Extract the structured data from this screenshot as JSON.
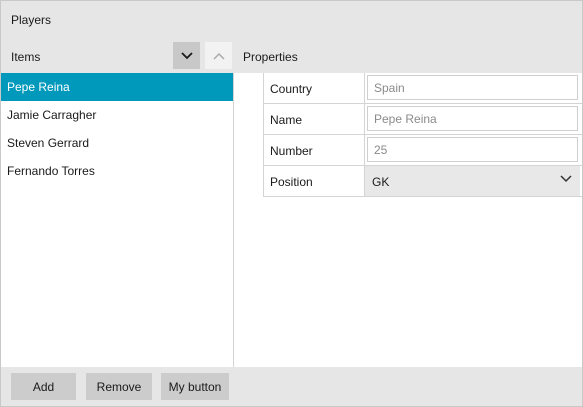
{
  "window": {
    "title": "Players"
  },
  "items_panel": {
    "header": "Items",
    "move_down_icon": "chevron-down-icon",
    "move_up_icon": "chevron-up-icon",
    "items": [
      {
        "label": "Pepe Reina",
        "selected": true
      },
      {
        "label": "Jamie Carragher",
        "selected": false
      },
      {
        "label": "Steven Gerrard",
        "selected": false
      },
      {
        "label": "Fernando Torres",
        "selected": false
      }
    ]
  },
  "properties_panel": {
    "header": "Properties",
    "rows": [
      {
        "label": "Country",
        "value": "Spain"
      },
      {
        "label": "Name",
        "value": "Pepe Reina"
      },
      {
        "label": "Number",
        "value": "25"
      },
      {
        "label": "Position",
        "value": "GK"
      }
    ]
  },
  "footer": {
    "add_label": "Add",
    "remove_label": "Remove",
    "custom_label": "My button"
  },
  "colors": {
    "selection": "#0099bc",
    "chrome": "#e6e6e6",
    "button": "#cccccc"
  }
}
